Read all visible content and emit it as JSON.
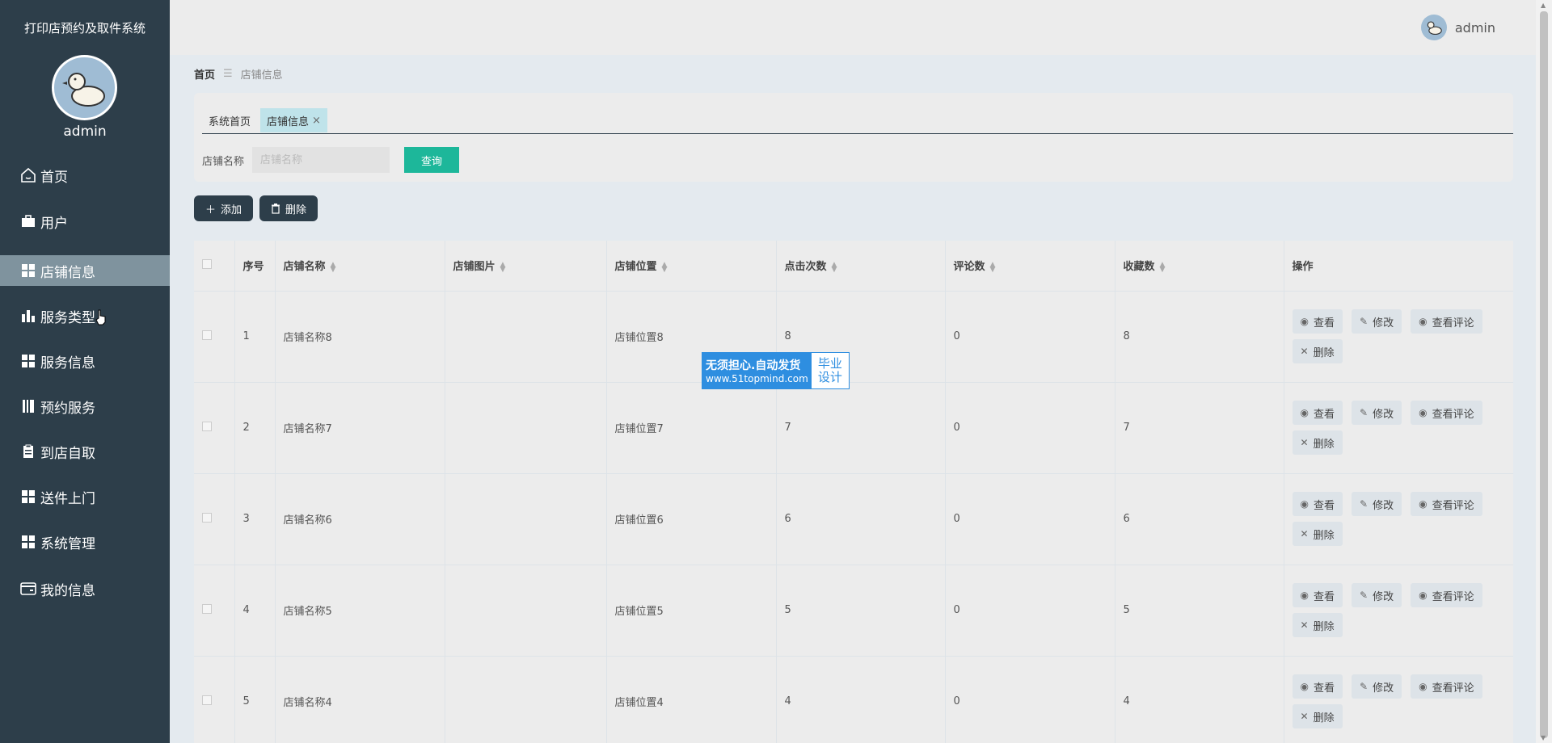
{
  "sidebar": {
    "app_title": "打印店预约及取件系统",
    "username": "admin",
    "items": [
      {
        "label": "首页",
        "icon": "home-icon"
      },
      {
        "label": "用户",
        "icon": "briefcase-icon"
      },
      {
        "label": "店铺信息",
        "icon": "grid-icon",
        "active": true
      },
      {
        "label": "服务类型",
        "icon": "bar-chart-icon"
      },
      {
        "label": "服务信息",
        "icon": "grid-icon"
      },
      {
        "label": "预约服务",
        "icon": "book-icon"
      },
      {
        "label": "到店自取",
        "icon": "clipboard-icon"
      },
      {
        "label": "送件上门",
        "icon": "grid-icon"
      },
      {
        "label": "系统管理",
        "icon": "grid-icon"
      },
      {
        "label": "我的信息",
        "icon": "wallet-icon"
      }
    ]
  },
  "topbar": {
    "username": "admin"
  },
  "breadcrumb": {
    "home": "首页",
    "current": "店铺信息"
  },
  "tabs": [
    {
      "label": "系统首页"
    },
    {
      "label": "店铺信息",
      "active": true,
      "close": "×"
    }
  ],
  "search": {
    "label": "店铺名称",
    "placeholder": "店铺名称",
    "button": "查询"
  },
  "actions": {
    "add": "添加",
    "delete": "删除"
  },
  "table": {
    "columns": [
      "序号",
      "店铺名称",
      "店铺图片",
      "店铺位置",
      "点击次数",
      "评论数",
      "收藏数",
      "操作"
    ],
    "rows": [
      {
        "index": "1",
        "name": "店铺名称8",
        "image": "",
        "location": "店铺位置8",
        "clicks": "8",
        "comments": "0",
        "favorites": "8"
      },
      {
        "index": "2",
        "name": "店铺名称7",
        "image": "",
        "location": "店铺位置7",
        "clicks": "7",
        "comments": "0",
        "favorites": "7"
      },
      {
        "index": "3",
        "name": "店铺名称6",
        "image": "",
        "location": "店铺位置6",
        "clicks": "6",
        "comments": "0",
        "favorites": "6"
      },
      {
        "index": "4",
        "name": "店铺名称5",
        "image": "",
        "location": "店铺位置5",
        "clicks": "5",
        "comments": "0",
        "favorites": "5"
      },
      {
        "index": "5",
        "name": "店铺名称4",
        "image": "",
        "location": "店铺位置4",
        "clicks": "4",
        "comments": "0",
        "favorites": "4"
      }
    ],
    "row_actions": {
      "view": "查看",
      "edit": "修改",
      "view_comments": "查看评论",
      "delete": "删除"
    }
  },
  "watermark": {
    "line1": "无须担心.自动发货",
    "line2": "www.51topmind.com",
    "right1": "毕业",
    "right2": "设计"
  },
  "colors": {
    "sidebar": "#2d3e4a",
    "accent": "#1db79a",
    "active_menu": "#7f939e",
    "watermark": "#2e8ee0"
  }
}
